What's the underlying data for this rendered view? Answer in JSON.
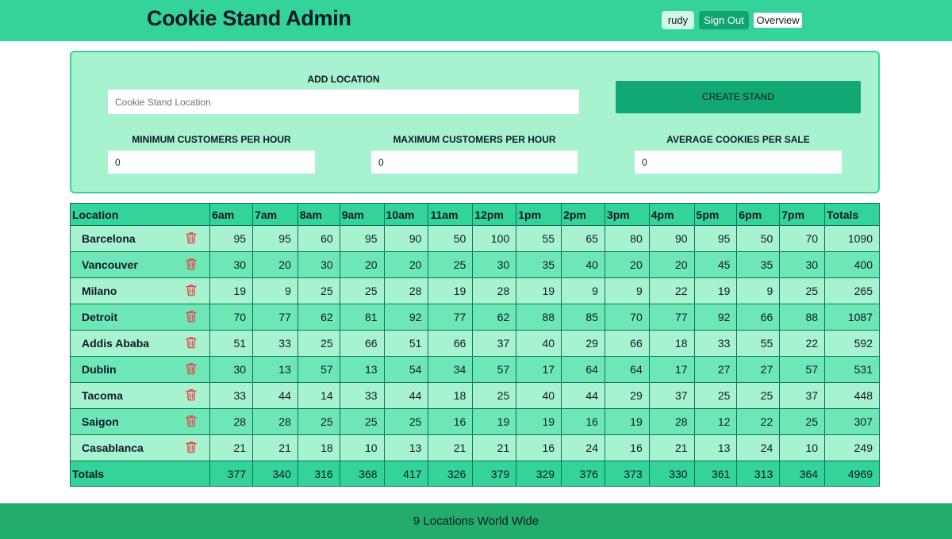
{
  "header": {
    "title": "Cookie Stand Admin",
    "user_label": "rudy",
    "signout_label": "Sign Out",
    "overview_label": "Overview"
  },
  "form": {
    "add_location_label": "ADD LOCATION",
    "location_placeholder": "Cookie Stand Location",
    "create_button_label": "CREATE STAND",
    "min_label": "MINIMUM CUSTOMERS PER HOUR",
    "min_value": "0",
    "max_label": "MAXIMUM CUSTOMERS PER HOUR",
    "max_value": "0",
    "avg_label": "AVERAGE COOKIES PER SALE",
    "avg_value": "0"
  },
  "table": {
    "location_header": "Location",
    "hours": [
      "6am",
      "7am",
      "8am",
      "9am",
      "10am",
      "11am",
      "12pm",
      "1pm",
      "2pm",
      "3pm",
      "4pm",
      "5pm",
      "6pm",
      "7pm"
    ],
    "totals_header": "Totals",
    "rows": [
      {
        "location": "Barcelona",
        "values": [
          95,
          95,
          60,
          95,
          90,
          50,
          100,
          55,
          65,
          80,
          90,
          95,
          50,
          70
        ],
        "total": 1090
      },
      {
        "location": "Vancouver",
        "values": [
          30,
          20,
          30,
          20,
          20,
          25,
          30,
          35,
          40,
          20,
          20,
          45,
          35,
          30
        ],
        "total": 400
      },
      {
        "location": "Milano",
        "values": [
          19,
          9,
          25,
          25,
          28,
          19,
          28,
          19,
          9,
          9,
          22,
          19,
          9,
          25
        ],
        "total": 265
      },
      {
        "location": "Detroit",
        "values": [
          70,
          77,
          62,
          81,
          92,
          77,
          62,
          88,
          85,
          70,
          77,
          92,
          66,
          88
        ],
        "total": 1087
      },
      {
        "location": "Addis Ababa",
        "values": [
          51,
          33,
          25,
          66,
          51,
          66,
          37,
          40,
          29,
          66,
          18,
          33,
          55,
          22
        ],
        "total": 592
      },
      {
        "location": "Dublin",
        "values": [
          30,
          13,
          57,
          13,
          54,
          34,
          57,
          17,
          64,
          64,
          17,
          27,
          27,
          57
        ],
        "total": 531
      },
      {
        "location": "Tacoma",
        "values": [
          33,
          44,
          14,
          33,
          44,
          18,
          25,
          40,
          44,
          29,
          37,
          25,
          25,
          37
        ],
        "total": 448
      },
      {
        "location": "Saigon",
        "values": [
          28,
          28,
          25,
          25,
          25,
          16,
          19,
          19,
          16,
          19,
          28,
          12,
          22,
          25
        ],
        "total": 307
      },
      {
        "location": "Casablanca",
        "values": [
          21,
          21,
          18,
          10,
          13,
          21,
          21,
          16,
          24,
          16,
          21,
          13,
          24,
          10
        ],
        "total": 249
      }
    ],
    "footer_label": "Totals",
    "footer_values": [
      377,
      340,
      316,
      368,
      417,
      326,
      379,
      329,
      376,
      373,
      330,
      361,
      313,
      364
    ],
    "footer_total": 4969,
    "row_icon": "trash-icon"
  },
  "footer": {
    "text": "9 Locations World Wide"
  },
  "colors": {
    "header_bg": "#34d399",
    "panel_bg": "#a7f3d0",
    "row_light": "#a7f3d0",
    "row_dark": "#6ee7b7",
    "footer_bg": "#22ad6d",
    "trash_icon": "#ef4444"
  }
}
